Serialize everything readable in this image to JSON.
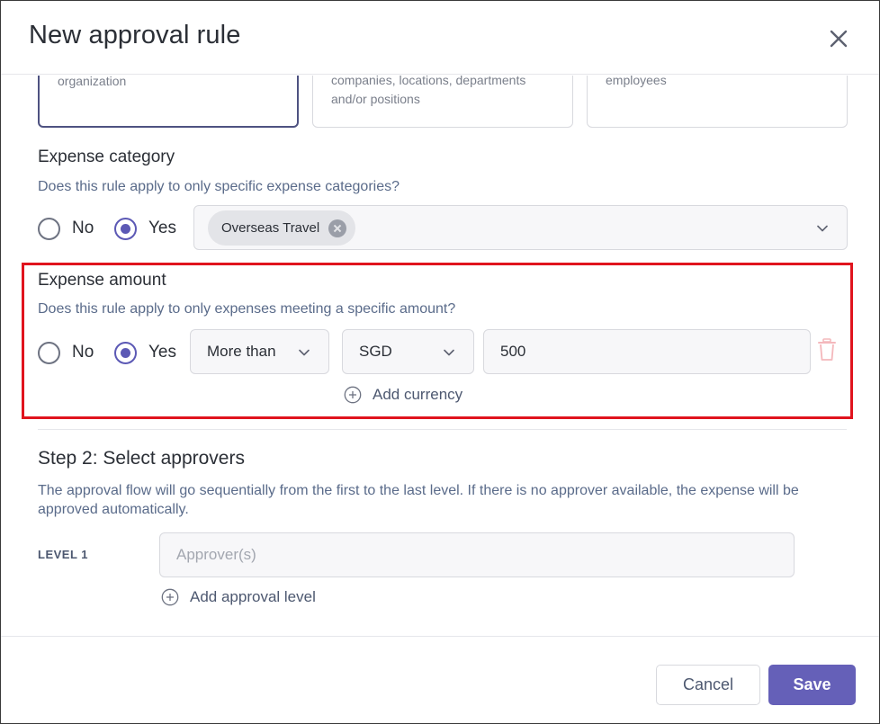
{
  "modal": {
    "title": "New approval rule",
    "close_icon": "close-icon"
  },
  "scope_cards": [
    {
      "desc": "organization",
      "selected": true
    },
    {
      "desc": "companies, locations, departments and/or positions",
      "selected": false
    },
    {
      "desc": "employees",
      "selected": false
    }
  ],
  "expense_category": {
    "title": "Expense category",
    "question": "Does this rule apply to only specific expense categories?",
    "option_no": "No",
    "option_yes": "Yes",
    "selected": "Yes",
    "chips": [
      "Overseas Travel"
    ]
  },
  "expense_amount": {
    "title": "Expense amount",
    "question": "Does this rule apply to only expenses meeting a specific amount?",
    "option_no": "No",
    "option_yes": "Yes",
    "selected": "Yes",
    "comparator": "More than",
    "currency": "SGD",
    "amount": "500",
    "add_currency_label": "Add currency"
  },
  "step2": {
    "title": "Step 2: Select approvers",
    "desc": "The approval flow will go sequentially from the first to the last level. If there is no approver available, the expense will be approved automatically.",
    "level_label": "LEVEL 1",
    "approver_placeholder": "Approver(s)",
    "add_level_label": "Add approval level"
  },
  "footer": {
    "cancel_label": "Cancel",
    "save_label": "Save"
  },
  "colors": {
    "accent": "#6560b8",
    "highlight": "#e0141e",
    "text": "#2b2f36",
    "muted": "#5a6b8a"
  }
}
